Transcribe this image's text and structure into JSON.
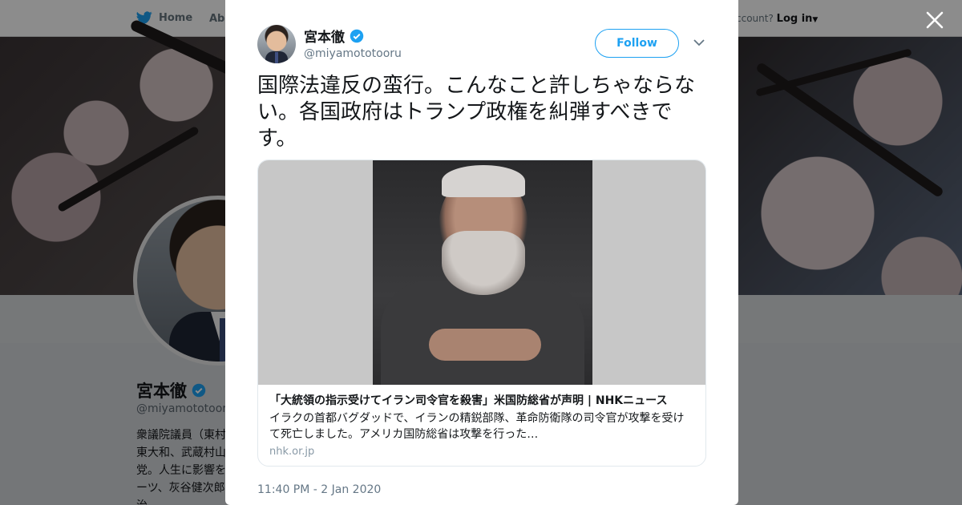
{
  "colors": {
    "accent": "#1da1f2",
    "text": "#14171a",
    "muted": "#657786",
    "overlay": "rgba(0,0,0,0.45)"
  },
  "background_page": {
    "nav": {
      "home_label": "Home",
      "about_label": "Abo",
      "account_prompt": "ccount?",
      "login_label": "Log in"
    },
    "profile": {
      "name": "宮本徹",
      "handle": "@miyamototooru",
      "bio": "衆議院議員（東村東大和、武蔵村山党。人生に影響をーツ、灰谷健次郎治。"
    }
  },
  "tweet": {
    "author_name": "宮本徹",
    "author_handle": "@miyamototooru",
    "verified": true,
    "follow_label": "Follow",
    "text": "国際法違反の蛮行。こんなこと許しちゃならない。各国政府はトランプ政権を糾弾すべきです。",
    "card": {
      "title": "「大統領の指示受けてイラン司令官を殺害」米国防総省が声明 | NHKニュース",
      "description": "イラクの首都バグダッドで、イランの精鋭部隊、革命防衛隊の司令官が攻撃を受けて死亡しました。アメリカ国防総省は攻撃を行った…",
      "domain": "nhk.or.jp"
    },
    "timestamp": "11:40 PM - 2 Jan 2020"
  },
  "icons": {
    "logo": "twitter-bird-icon",
    "verified": "verified-badge-icon",
    "close": "close-icon",
    "menu": "chevron-down-icon"
  }
}
